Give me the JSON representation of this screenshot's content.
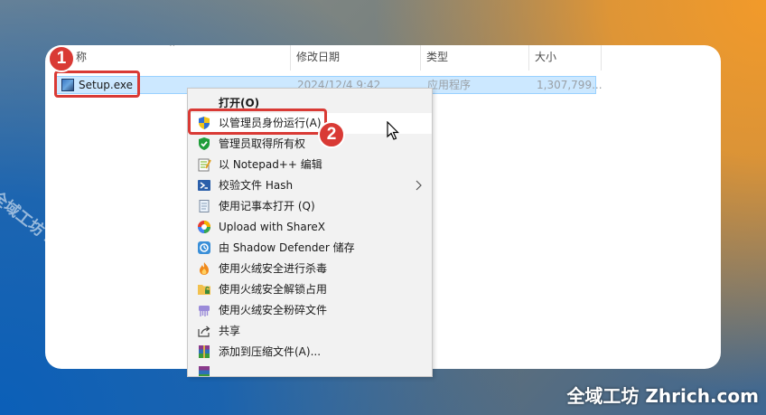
{
  "explorer": {
    "columns": {
      "name_fragment": "称",
      "date_modified": "修改日期",
      "type": "类型",
      "size": "大小"
    },
    "file": {
      "name": "Setup.exe",
      "date": "2024/12/4 9:42",
      "type": "应用程序",
      "size": "1,307,799..."
    }
  },
  "context_menu": {
    "items": [
      {
        "label": "打开(O)",
        "icon": "none",
        "bold": true
      },
      {
        "label": "以管理员身份运行(A)",
        "icon": "uac-shield-icon",
        "highlighted": true
      },
      {
        "label": "管理员取得所有权",
        "icon": "green-shield-check-icon"
      },
      {
        "label": "以 Notepad++ 编辑",
        "icon": "notepad-plus-plus-icon"
      },
      {
        "label": "校验文件 Hash",
        "icon": "powershell-icon",
        "submenu": true
      },
      {
        "label": "使用记事本打开 (Q)",
        "icon": "notepad-icon"
      },
      {
        "label": "Upload with ShareX",
        "icon": "sharex-icon"
      },
      {
        "label": "由 Shadow Defender 储存",
        "icon": "shadow-defender-icon"
      },
      {
        "label": "使用火绒安全进行杀毒",
        "icon": "huorong-flame-icon"
      },
      {
        "label": "使用火绒安全解锁占用",
        "icon": "folder-unlock-icon"
      },
      {
        "label": "使用火绒安全粉碎文件",
        "icon": "shredder-icon"
      },
      {
        "label": "共享",
        "icon": "share-icon"
      },
      {
        "label": "添加到压缩文件(A)...",
        "icon": "winrar-icon"
      },
      {
        "label": "",
        "icon": "winrar-icon"
      }
    ]
  },
  "annotations": {
    "step1": "1",
    "step2": "2",
    "highlight_color": "#d93a35"
  },
  "watermark": {
    "diagonal": "全域工坊 zhrich.com",
    "corner": "全域工坊 Zhrich.com"
  },
  "colors": {
    "selection_bg": "#cce8ff",
    "menu_bg": "#f2f2f2",
    "accent_red": "#d93a35"
  }
}
